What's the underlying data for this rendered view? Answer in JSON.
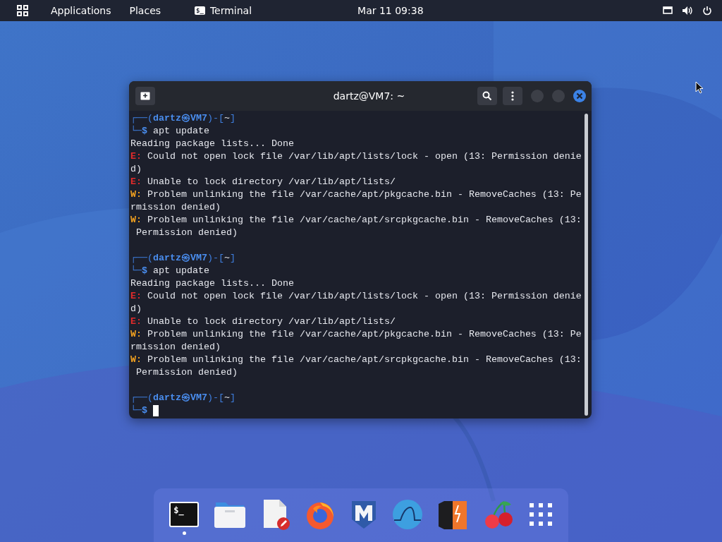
{
  "top_bar": {
    "menus": [
      {
        "label": "Applications"
      },
      {
        "label": "Places"
      }
    ],
    "app": {
      "glyph": "$_",
      "label": "Terminal"
    },
    "clock": "Mar 11  09:38"
  },
  "window": {
    "title": "dartz@VM7: ~",
    "lines": [
      {
        "kind": "text",
        "segments": [
          {
            "kind": "frame",
            "text": "┌──("
          },
          {
            "kind": "user",
            "text": "dartz㉿VM7"
          },
          {
            "kind": "frame",
            "text": ")-["
          },
          {
            "kind": "plain",
            "text": "~"
          },
          {
            "kind": "frame",
            "text": "]"
          }
        ]
      },
      {
        "kind": "text",
        "segments": [
          {
            "kind": "frame",
            "text": "└─"
          },
          {
            "kind": "user",
            "text": "$"
          },
          {
            "kind": "plain",
            "text": " apt update"
          }
        ]
      },
      {
        "kind": "text",
        "segments": [
          {
            "kind": "plain",
            "text": "Reading package lists... Done"
          }
        ]
      },
      {
        "kind": "text",
        "segments": [
          {
            "kind": "error",
            "text": "E:"
          },
          {
            "kind": "plain",
            "text": " Could not open lock file /var/lib/apt/lists/lock - open (13: Permission denie"
          }
        ]
      },
      {
        "kind": "text",
        "segments": [
          {
            "kind": "plain",
            "text": "d)"
          }
        ]
      },
      {
        "kind": "text",
        "segments": [
          {
            "kind": "error",
            "text": "E:"
          },
          {
            "kind": "plain",
            "text": " Unable to lock directory /var/lib/apt/lists/"
          }
        ]
      },
      {
        "kind": "text",
        "segments": [
          {
            "kind": "warning",
            "text": "W:"
          },
          {
            "kind": "plain",
            "text": " Problem unlinking the file /var/cache/apt/pkgcache.bin - RemoveCaches (13: Pe"
          }
        ]
      },
      {
        "kind": "text",
        "segments": [
          {
            "kind": "plain",
            "text": "rmission denied)"
          }
        ]
      },
      {
        "kind": "text",
        "segments": [
          {
            "kind": "warning",
            "text": "W:"
          },
          {
            "kind": "plain",
            "text": " Problem unlinking the file /var/cache/apt/srcpkgcache.bin - RemoveCaches (13:"
          }
        ]
      },
      {
        "kind": "text",
        "segments": [
          {
            "kind": "plain",
            "text": " Permission denied)"
          }
        ]
      },
      {
        "kind": "blank"
      },
      {
        "kind": "text",
        "segments": [
          {
            "kind": "frame",
            "text": "┌──("
          },
          {
            "kind": "user",
            "text": "dartz㉿VM7"
          },
          {
            "kind": "frame",
            "text": ")-["
          },
          {
            "kind": "plain",
            "text": "~"
          },
          {
            "kind": "frame",
            "text": "]"
          }
        ]
      },
      {
        "kind": "text",
        "segments": [
          {
            "kind": "frame",
            "text": "└─"
          },
          {
            "kind": "user",
            "text": "$"
          },
          {
            "kind": "plain",
            "text": " apt update"
          }
        ]
      },
      {
        "kind": "text",
        "segments": [
          {
            "kind": "plain",
            "text": "Reading package lists... Done"
          }
        ]
      },
      {
        "kind": "text",
        "segments": [
          {
            "kind": "error",
            "text": "E:"
          },
          {
            "kind": "plain",
            "text": " Could not open lock file /var/lib/apt/lists/lock - open (13: Permission denie"
          }
        ]
      },
      {
        "kind": "text",
        "segments": [
          {
            "kind": "plain",
            "text": "d)"
          }
        ]
      },
      {
        "kind": "text",
        "segments": [
          {
            "kind": "error",
            "text": "E:"
          },
          {
            "kind": "plain",
            "text": " Unable to lock directory /var/lib/apt/lists/"
          }
        ]
      },
      {
        "kind": "text",
        "segments": [
          {
            "kind": "warning",
            "text": "W:"
          },
          {
            "kind": "plain",
            "text": " Problem unlinking the file /var/cache/apt/pkgcache.bin - RemoveCaches (13: Pe"
          }
        ]
      },
      {
        "kind": "text",
        "segments": [
          {
            "kind": "plain",
            "text": "rmission denied)"
          }
        ]
      },
      {
        "kind": "text",
        "segments": [
          {
            "kind": "warning",
            "text": "W:"
          },
          {
            "kind": "plain",
            "text": " Problem unlinking the file /var/cache/apt/srcpkgcache.bin - RemoveCaches (13:"
          }
        ]
      },
      {
        "kind": "text",
        "segments": [
          {
            "kind": "plain",
            "text": " Permission denied)"
          }
        ]
      },
      {
        "kind": "blank"
      },
      {
        "kind": "text",
        "segments": [
          {
            "kind": "frame",
            "text": "┌──("
          },
          {
            "kind": "user",
            "text": "dartz㉿VM7"
          },
          {
            "kind": "frame",
            "text": ")-["
          },
          {
            "kind": "plain",
            "text": "~"
          },
          {
            "kind": "frame",
            "text": "]"
          }
        ]
      },
      {
        "kind": "input",
        "segments": [
          {
            "kind": "frame",
            "text": "└─"
          },
          {
            "kind": "user",
            "text": "$"
          }
        ]
      }
    ]
  },
  "dock": [
    {
      "kind": "terminal",
      "glyph": "$_",
      "running": true
    },
    {
      "kind": "files",
      "running": false
    },
    {
      "kind": "editor",
      "running": false
    },
    {
      "kind": "browser",
      "running": false
    },
    {
      "kind": "shield",
      "running": false
    },
    {
      "kind": "fin",
      "running": false
    },
    {
      "kind": "bolt",
      "running": false
    },
    {
      "kind": "cherry",
      "running": false
    },
    {
      "kind": "apps",
      "running": false
    }
  ]
}
